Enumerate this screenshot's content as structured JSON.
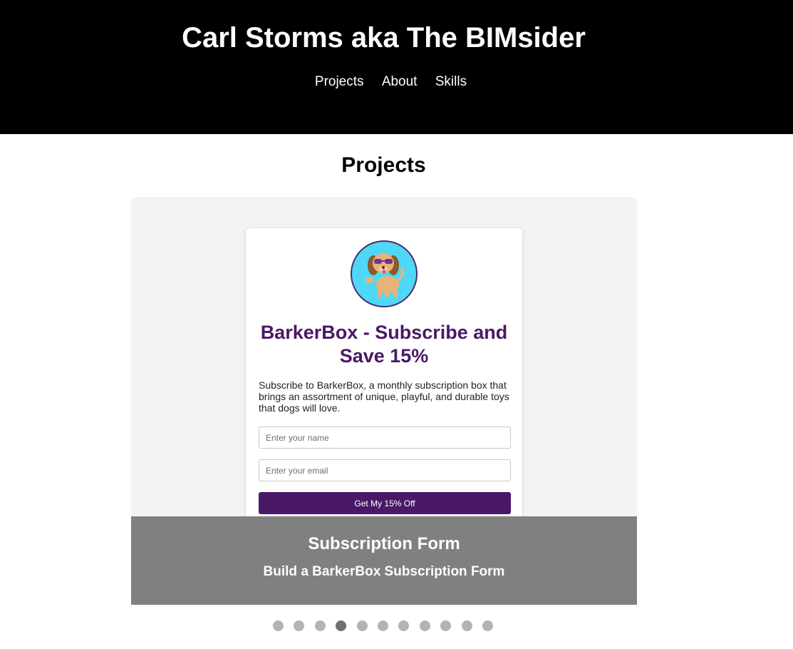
{
  "header": {
    "title": "Carl Storms aka The BIMsider",
    "nav": [
      "Projects",
      "About",
      "Skills"
    ]
  },
  "projects": {
    "section_title": "Projects",
    "slide": {
      "logo_icon": "dog-with-sunglasses-logo",
      "heading": "BarkerBox - Subscribe and Save 15%",
      "description": "Subscribe to BarkerBox, a monthly subscription box that brings an assortment of unique, playful, and durable toys that dogs will love.",
      "name_placeholder": "Enter your name",
      "email_placeholder": "Enter your email",
      "button_label": "Get My 15% Off"
    },
    "caption": {
      "title": "Subscription Form",
      "subtitle": "Build a BarkerBox Subscription Form"
    },
    "carousel": {
      "total_slides": 11,
      "active_index": 3
    }
  },
  "colors": {
    "header_bg": "#000000",
    "brand_purple": "#4a1866",
    "logo_bg": "#4fd8f5",
    "caption_bg": "#808080",
    "dot_inactive": "#b3b3b3",
    "dot_active": "#6f6f6f"
  }
}
